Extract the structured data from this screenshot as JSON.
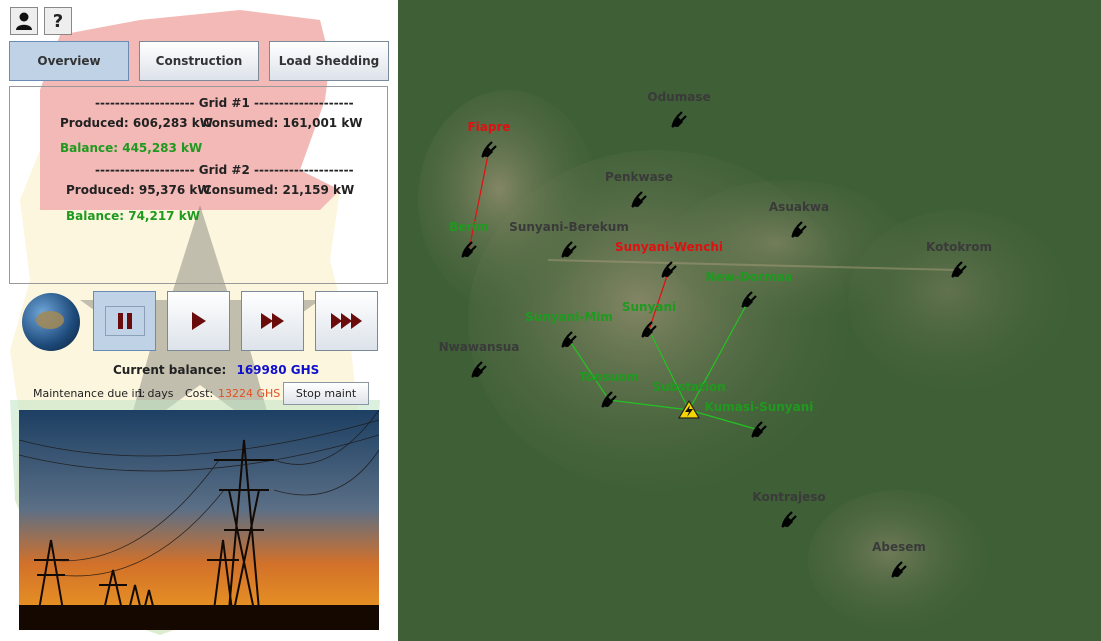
{
  "toolbar": {
    "user_icon": "user-icon",
    "help_label": "?"
  },
  "tabs": [
    {
      "label": "Overview",
      "active": true
    },
    {
      "label": "Construction",
      "active": false
    },
    {
      "label": "Load Shedding",
      "active": false
    }
  ],
  "grids": [
    {
      "header": "-------------------- Grid #1 --------------------",
      "produced": "Produced: 606,283 kW",
      "consumed": "Consumed: 161,001 kW",
      "balance": "Balance: 445,283 kW"
    },
    {
      "header": "-------------------- Grid #2 --------------------",
      "produced": "Produced: 95,376 kW",
      "consumed": "Consumed: 21,159 kW",
      "balance": "Balance: 74,217 kW"
    }
  ],
  "controls": {
    "pause": "pause-icon",
    "play": "play-icon",
    "fast": "fast-forward-icon",
    "faster": "faster-forward-icon"
  },
  "status": {
    "balance_label": "Current balance:",
    "balance_value": "169980 GHS",
    "maint_label": "Maintenance due in:",
    "maint_days": "1 days",
    "cost_label": "Cost:",
    "cost_value": "13224 GHS",
    "stop_label": "Stop maint"
  },
  "colors": {
    "green": "#1e9a1e",
    "red": "#e01010",
    "gray": "#3a3a3a",
    "blue": "#1010cc",
    "orange": "#e05020"
  },
  "map": {
    "cities": [
      {
        "name": "Odumase",
        "color": "gray"
      },
      {
        "name": "Fiapre",
        "color": "red"
      },
      {
        "name": "Penkwase",
        "color": "gray"
      },
      {
        "name": "Asuakwa",
        "color": "gray"
      },
      {
        "name": "Berim",
        "color": "green"
      },
      {
        "name": "Sunyani-Berekum",
        "color": "gray"
      },
      {
        "name": "Sunyani-Wenchi",
        "color": "red"
      },
      {
        "name": "Kotokrom",
        "color": "gray"
      },
      {
        "name": "New-Dormaa",
        "color": "green"
      },
      {
        "name": "Sunyani-Mim",
        "color": "green"
      },
      {
        "name": "Sunyani",
        "color": "green"
      },
      {
        "name": "Nwawansua",
        "color": "gray"
      },
      {
        "name": "Tonsuom",
        "color": "green"
      },
      {
        "name": "Substation",
        "color": "green"
      },
      {
        "name": "Kumasi-Sunyani",
        "color": "green"
      },
      {
        "name": "Kontrajeso",
        "color": "gray"
      },
      {
        "name": "Abesem",
        "color": "gray"
      }
    ]
  }
}
